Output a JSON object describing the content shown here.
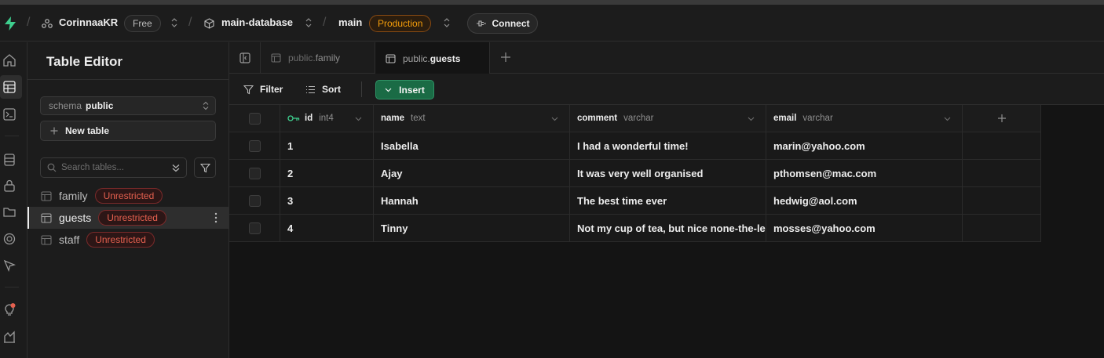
{
  "topbar": {
    "org": "CorinnaaKR",
    "plan": "Free",
    "project": "main-database",
    "branch": "main",
    "env": "Production",
    "connect_label": "Connect"
  },
  "sidebar": {
    "title": "Table Editor",
    "schema_label": "schema",
    "schema_value": "public",
    "new_table_label": "New table",
    "search_placeholder": "Search tables...",
    "tables": [
      {
        "name": "family",
        "badge": "Unrestricted"
      },
      {
        "name": "guests",
        "badge": "Unrestricted",
        "active": true
      },
      {
        "name": "staff",
        "badge": "Unrestricted"
      }
    ]
  },
  "tabs": [
    {
      "schema": "public.",
      "table": "family"
    },
    {
      "schema": "public.",
      "table": "guests",
      "active": true
    }
  ],
  "toolbar": {
    "filter_label": "Filter",
    "sort_label": "Sort",
    "insert_label": "Insert"
  },
  "grid": {
    "columns": [
      {
        "name": "id",
        "type": "int4",
        "primary_key": true
      },
      {
        "name": "name",
        "type": "text"
      },
      {
        "name": "comment",
        "type": "varchar"
      },
      {
        "name": "email",
        "type": "varchar"
      }
    ],
    "rows": [
      [
        "1",
        "Isabella",
        "I had a wonderful time!",
        "marin@yahoo.com"
      ],
      [
        "2",
        "Ajay",
        "It was very well organised",
        "pthomsen@mac.com"
      ],
      [
        "3",
        "Hannah",
        "The best time ever",
        "hedwig@aol.com"
      ],
      [
        "4",
        "Tinny",
        "Not my cup of tea, but nice none-the-less",
        "mosses@yahoo.com"
      ]
    ]
  },
  "colors": {
    "accent_green": "#3ecf8e",
    "insert_bg": "#1a6b45",
    "badge_red": "#e5604f",
    "production_orange": "#f59e0b"
  },
  "icons": {
    "logo": "supabase-logo-icon",
    "org": "org-icon",
    "project": "project-cube-icon",
    "rail": [
      "home-icon",
      "table-editor-icon",
      "sql-editor-icon",
      "database-icon",
      "auth-icon",
      "storage-icon",
      "realtime-icon",
      "advisor-icon",
      "tips-icon",
      "reports-icon"
    ]
  }
}
